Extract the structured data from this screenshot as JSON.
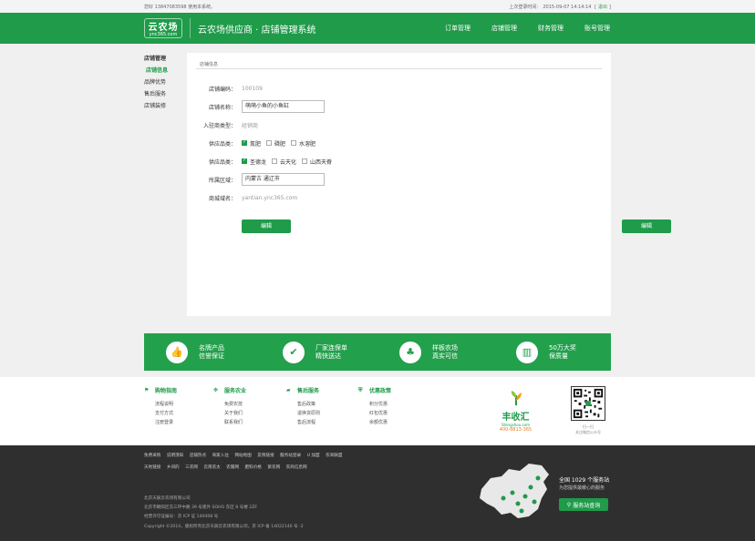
{
  "topbar": {
    "left_text": "您好 13847083598 使用本系统。",
    "login_label": "上次登录时间：",
    "login_time": "2015-09-07 14:14:14",
    "bracket_l": "[",
    "logout": "退出",
    "bracket_r": "]"
  },
  "header": {
    "logo_main": "云农场",
    "logo_sub": "ync365.com",
    "title": "云农场供应商 · 店铺管理系统"
  },
  "nav": [
    "订单管理",
    "店铺管理",
    "财务管理",
    "账号管理"
  ],
  "sidebar": {
    "heading": "店铺管理",
    "items": [
      "店铺信息",
      "品牌优势",
      "售后服务",
      "店铺装修"
    ]
  },
  "panel": {
    "title": "店铺信息",
    "shop_code_label": "店铺编码：",
    "shop_code": "100109",
    "shop_name_label": "店铺名称：",
    "shop_name": "萌萌小鱼的小鱼缸",
    "type_label": "入驻商类型：",
    "type_value": "经销商",
    "supply1_label": "供应品类：",
    "supply1": [
      {
        "label": "氮肥",
        "checked": true
      },
      {
        "label": "磷肥",
        "checked": false
      },
      {
        "label": "水溶肥",
        "checked": false
      }
    ],
    "supply2_label": "供应品类：",
    "supply2": [
      {
        "label": "圣德龙",
        "checked": true
      },
      {
        "label": "云天化",
        "checked": false
      },
      {
        "label": "山西天脊",
        "checked": false
      }
    ],
    "region_label": "所属区域：",
    "region": "内蒙古 通辽市",
    "domain_label": "商城域名：",
    "domain": "yantian.ync365.com",
    "edit_label": "编辑"
  },
  "side_button": "编辑",
  "features": [
    {
      "icon": "thumbs-up-icon",
      "glyph": "👍",
      "line1": "名牌产品",
      "line2": "信誉保证"
    },
    {
      "icon": "check-icon",
      "glyph": "✔",
      "line1": "厂家连保单",
      "line2": "精快送达"
    },
    {
      "icon": "sprout-icon",
      "glyph": "♣",
      "line1": "样板农场",
      "line2": "真实可信"
    },
    {
      "icon": "barcode-icon",
      "glyph": "▥",
      "line1": "50万大奖",
      "line2": "保质量"
    }
  ],
  "footer_cols": [
    {
      "icon": "flag-icon",
      "glyph": "⚑",
      "title": "购物指南",
      "items": [
        "流程说明",
        "支付方式",
        "注册登录"
      ]
    },
    {
      "icon": "handshake-icon",
      "glyph": "✥",
      "title": "服务农业",
      "items": [
        "免费农技",
        "关于我们",
        "联系我们"
      ]
    },
    {
      "icon": "truck-icon",
      "glyph": "▰",
      "title": "售后服务",
      "items": [
        "售后政策",
        "退换货原则",
        "售后流程"
      ]
    },
    {
      "icon": "shield-icon",
      "glyph": "⛨",
      "title": "优惠政策",
      "items": [
        "积分优惠",
        "红包优惠",
        "余额优惠"
      ]
    }
  ],
  "brand": {
    "name": "丰收汇",
    "site": "Stengshou.com",
    "tel": "400-8813-365"
  },
  "qr": {
    "line1": "扫一扫",
    "line2": "关注微信公众号"
  },
  "links1": [
    "免费采购",
    "说明须知",
    "店铺热点",
    "商家入驻",
    "网站地图",
    "友情链接",
    "服务站登录",
    "U 加盟",
    "农商联盟"
  ],
  "links2": [
    "天地链接",
    "乡间的",
    "三农网",
    "云南农太",
    "农服网",
    "肥料价格",
    "紫农网",
    "农商信息网"
  ],
  "legal": [
    "北京天辰云农场有限公司",
    "北京市朝阳区东三环中路 39 号建外 SOHO 东区 8 号楼 2ZF",
    "经营许可证编号：京 ICP 证 140408 号",
    "Copyright ©2014，版权所有北京天辰云农场有限公司，京 ICP 备 14022140 号 -2"
  ],
  "map_stat": {
    "line1": "全国 1029 个服务站",
    "line2": "为您提供最暖心的服务",
    "button": "服务站查询"
  },
  "colors": {
    "brand_green": "#1f9b4a",
    "footer_dark": "#2f2f2f"
  }
}
